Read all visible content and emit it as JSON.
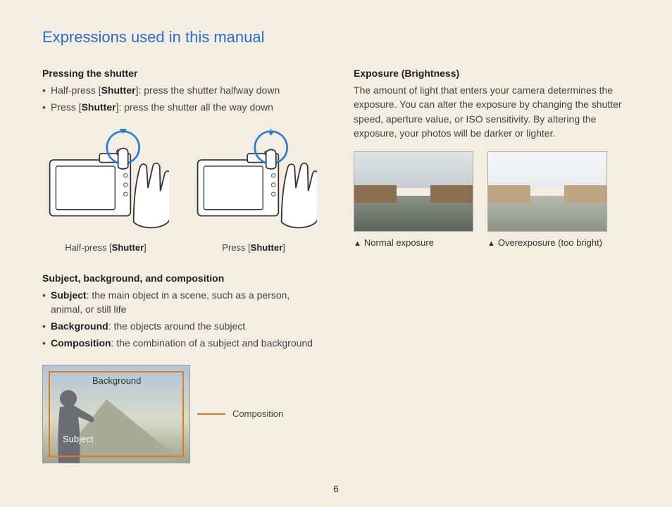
{
  "title": "Expressions used in this manual",
  "pageNumber": "6",
  "left": {
    "section1": {
      "heading": "Pressing the shutter",
      "bullets": [
        {
          "prefix": "Half-press [",
          "bold": "Shutter",
          "suffix": "]: press the shutter halfway down"
        },
        {
          "prefix": "Press [",
          "bold": "Shutter",
          "suffix": "]: press the shutter all the way down"
        }
      ],
      "figs": [
        {
          "caption_pre": "Half-press [",
          "caption_bold": "Shutter",
          "caption_post": "]"
        },
        {
          "caption_pre": "Press [",
          "caption_bold": "Shutter",
          "caption_post": "]"
        }
      ]
    },
    "section2": {
      "heading": "Subject, background, and composition",
      "bullets": [
        {
          "bold": "Subject",
          "rest": ": the main object in a scene, such as a person, animal, or still life"
        },
        {
          "bold": "Background",
          "rest": ": the objects around the subject"
        },
        {
          "bold": "Composition",
          "rest": ": the combination of a subject and background"
        }
      ],
      "illus": {
        "background": "Background",
        "subject": "Subject",
        "composition": "Composition"
      }
    }
  },
  "right": {
    "heading": "Exposure (Brightness)",
    "paragraph": "The amount of light that enters your camera determines the exposure. You can alter the exposure by changing the shutter speed, aperture value, or ISO sensitivity. By altering the exposure, your photos will be darker or lighter.",
    "figs": [
      {
        "caption": "Normal exposure"
      },
      {
        "caption": "Overexposure (too bright)"
      }
    ]
  }
}
